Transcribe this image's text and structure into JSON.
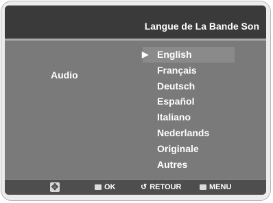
{
  "header": {
    "title": "Langue de La Bande Son"
  },
  "audio": {
    "label": "Audio"
  },
  "languages": {
    "selected_index": 0,
    "items": [
      "English",
      "Français",
      "Deutsch",
      "Español",
      "Italiano",
      "Nederlands",
      "Originale",
      "Autres"
    ]
  },
  "footer": {
    "navigate_icon": "navigate-arrows-icon",
    "ok_label": "OK",
    "return_label": "RETOUR",
    "menu_label": "MENU"
  },
  "colors": {
    "frame": "#ececec",
    "header_bg": "#3a3a3a",
    "content_bg": "#7a7a7a",
    "selected_bg": "#8a8a8a",
    "footer_bg": "#4e4e4e",
    "text": "#ffffff"
  }
}
